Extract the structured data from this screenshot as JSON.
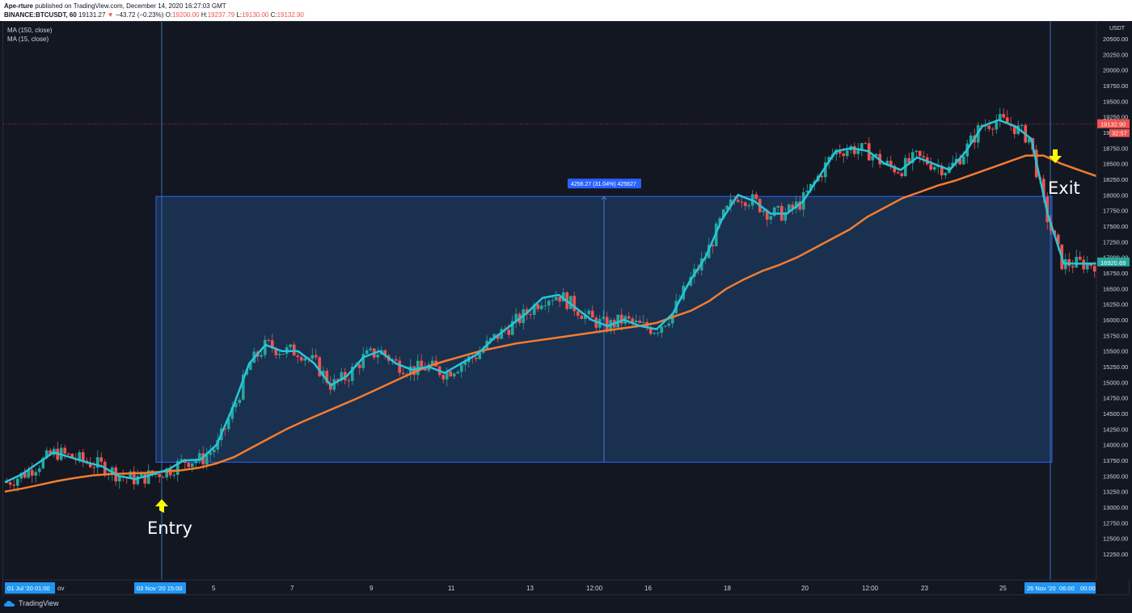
{
  "header": {
    "publisher": "Ape-rture",
    "published_text": "published on TradingView.com, December 14, 2020 16:27:03 GMT",
    "symbol": "BINANCE:BTCUSDT, 60",
    "last": "19131.27",
    "change": "−43.72 (−0.23%)",
    "ohlc": {
      "o_label": "O:",
      "o": "19200.00",
      "h_label": "H:",
      "h": "19237.79",
      "l_label": "L:",
      "l": "19130.00",
      "c_label": "C:",
      "c": "19132.90"
    }
  },
  "indicators": [
    "MA (150, close)",
    "MA (15, close)"
  ],
  "annotations": {
    "entry": "Entry",
    "exit": "Exit"
  },
  "measure_label": "4256.27 (31.04%) 425627",
  "footer": {
    "brand": "TradingView"
  },
  "colors": {
    "background": "#131722",
    "ma150": "#f57c30",
    "ma15": "#26c6da",
    "up": "#26a69a",
    "down": "#ef5350",
    "range_fill": "#1e3a5f",
    "range_border": "#2962ff",
    "arrow": "#ffff00",
    "price_tag": "#ef5350",
    "current_tag": "#26a69a",
    "axis_tag": "#2196f3"
  },
  "chart_data": {
    "type": "line",
    "title": "",
    "xlabel": "",
    "ylabel": "USDT",
    "y_unit": "USDT",
    "ylim": [
      12000,
      20750
    ],
    "y_ticks": [
      "12250.00",
      "12500.00",
      "12750.00",
      "13000.00",
      "13250.00",
      "13500.00",
      "13750.00",
      "14000.00",
      "14250.00",
      "14500.00",
      "14750.00",
      "15000.00",
      "15250.00",
      "15500.00",
      "15750.00",
      "16000.00",
      "16250.00",
      "16500.00",
      "16750.00",
      "17000.00",
      "17250.00",
      "17500.00",
      "17750.00",
      "18000.00",
      "18250.00",
      "18500.00",
      "18750.00",
      "19000.00",
      "19250.00",
      "19500.00",
      "19750.00",
      "20000.00",
      "20250.00",
      "20500.00"
    ],
    "x_ticks": [
      "5",
      "7",
      "9",
      "11",
      "13",
      "12:00",
      "16",
      "18",
      "20",
      "12:00",
      "23",
      "25"
    ],
    "x_axis_labels": {
      "start": "01 Jul '20   01:00",
      "start_suffix": "ov",
      "entry": "03 Nov '20   15:00",
      "exit": "26 Nov '20",
      "exit_time": "06:00",
      "end": "00:00"
    },
    "price_tags": {
      "last": "19132.90",
      "countdown": "32:57",
      "current": "16920.69"
    },
    "measurement": {
      "from_price": 13720,
      "to_price": 17976,
      "change": 4256.27,
      "change_pct": 31.04
    },
    "series": [
      {
        "name": "MA (15, close)",
        "values": [
          13400,
          13520,
          13700,
          13880,
          13800,
          13720,
          13650,
          13500,
          13450,
          13520,
          13600,
          13750,
          13760,
          14000,
          14600,
          15300,
          15600,
          15500,
          15500,
          15300,
          14950,
          15100,
          15400,
          15500,
          15300,
          15200,
          15250,
          15150,
          15300,
          15450,
          15700,
          15900,
          16100,
          16350,
          16400,
          16200,
          16000,
          15900,
          16000,
          15900,
          15850,
          16100,
          16600,
          17000,
          17600,
          18000,
          17900,
          17700,
          17700,
          17900,
          18300,
          18700,
          18750,
          18700,
          18500,
          18400,
          18600,
          18500,
          18400,
          18700,
          19100,
          19200,
          19100,
          18900,
          17700,
          16900,
          16900,
          16900
        ]
      },
      {
        "name": "MA (150, close)",
        "values": [
          13250,
          13300,
          13360,
          13420,
          13470,
          13510,
          13530,
          13540,
          13550,
          13570,
          13590,
          13630,
          13700,
          13800,
          13950,
          14100,
          14250,
          14380,
          14500,
          14620,
          14740,
          14870,
          15000,
          15130,
          15250,
          15340,
          15420,
          15500,
          15560,
          15620,
          15660,
          15700,
          15740,
          15780,
          15820,
          15860,
          15900,
          15950,
          16050,
          16150,
          16300,
          16500,
          16650,
          16780,
          16880,
          17000,
          17150,
          17300,
          17450,
          17650,
          17800,
          17950,
          18050,
          18150,
          18230,
          18330,
          18430,
          18530,
          18630,
          18630,
          18500,
          18400,
          18300
        ]
      }
    ]
  }
}
